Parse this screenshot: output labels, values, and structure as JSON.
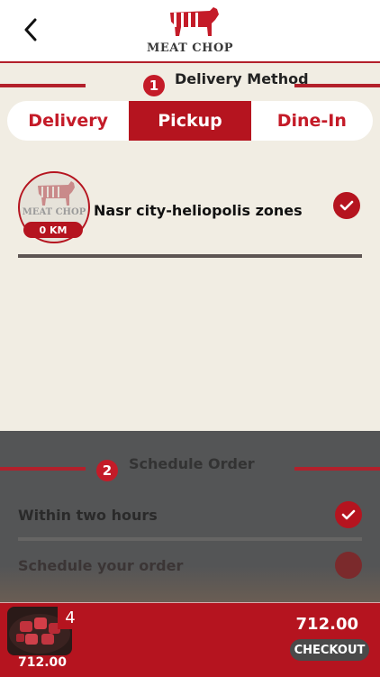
{
  "header": {
    "logo_text": "MEAT CHOP"
  },
  "delivery_section": {
    "step": "1",
    "title": "Delivery Method",
    "tabs": [
      {
        "label": "Delivery",
        "active": false
      },
      {
        "label": "Pickup",
        "active": true
      },
      {
        "label": "Dine-In",
        "active": false
      }
    ]
  },
  "branch": {
    "logo_text": "MEAT CHOP",
    "distance": "0 KM",
    "name": "Nasr city-heliopolis zones",
    "selected": true
  },
  "schedule_section": {
    "step": "2",
    "title": "Schedule Order",
    "options": [
      {
        "label": "Within two hours",
        "selected": true
      },
      {
        "label": "Schedule your order",
        "selected": false
      }
    ]
  },
  "cart": {
    "count": "4",
    "thumb_total": "712.00",
    "total": "712.00",
    "checkout_label": "CHECKOUT"
  },
  "colors": {
    "brand_red": "#b5141f",
    "background": "#f1ede3",
    "overlay": "#545556"
  }
}
